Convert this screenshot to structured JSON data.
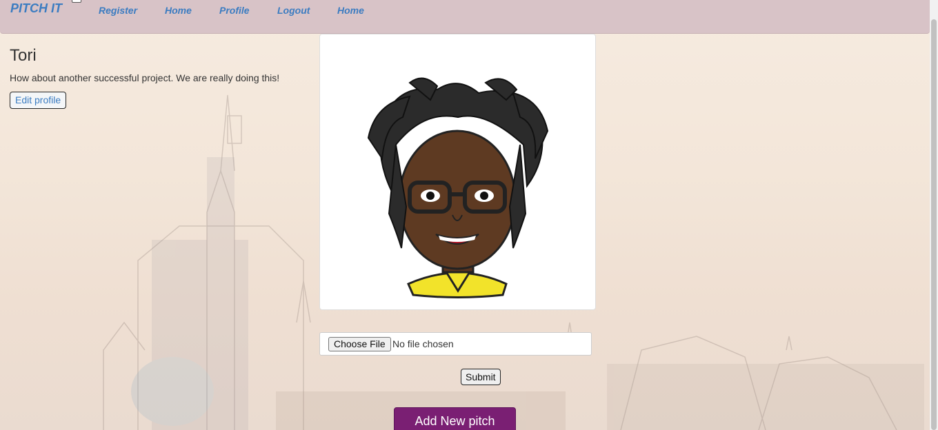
{
  "navbar": {
    "brand": "PITCH IT",
    "links": [
      "Register",
      "Home",
      "Profile",
      "Logout",
      "Home"
    ]
  },
  "profile": {
    "username": "Tori",
    "bio": "How about another successful project. We are really doing this!",
    "edit_label": "Edit profile"
  },
  "upload": {
    "choose_label": "Choose File",
    "status": "No file chosen",
    "submit_label": "Submit"
  },
  "actions": {
    "add_pitch_label": "Add New pitch"
  },
  "colors": {
    "navbar_bg": "#d8c3c7",
    "link": "#3b7cc1",
    "add_pitch_bg": "#7a1f73"
  }
}
